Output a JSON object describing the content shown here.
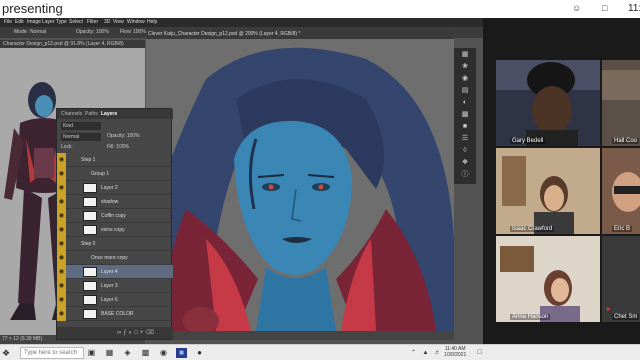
{
  "top": {
    "title": "presenting",
    "clock": "11:"
  },
  "photoshop": {
    "menus": [
      "File",
      "Edit",
      "Image",
      "Layer",
      "Type",
      "Select",
      "Filter",
      "3D",
      "View",
      "Window",
      "Help"
    ],
    "options": {
      "mode_label": "Mode:",
      "mode_value": "Normal",
      "opacity_label": "Opacity:",
      "opacity_value": "100%",
      "flow_label": "Flow:",
      "flow_value": "100%"
    },
    "doc1": {
      "tab": "Character Design_p12.psd @ 91.8% (Layer 4, RGB/8)",
      "status": "77 × 12 (8.38 MB)"
    },
    "doc2": {
      "tab": "Clever Kaiju_Character Design_p12.psd @ 200% (Layer 4, RGB/8) *",
      "status": "200%"
    },
    "layers_panel": {
      "tabs": [
        "Channels",
        "Paths",
        "Layers"
      ],
      "kind_label": "Kind",
      "blend_mode": "Normal",
      "opacity_label": "Opacity:",
      "opacity_value": "100%",
      "lock_label": "Lock:",
      "fill_label": "Fill:",
      "fill_value": "100%",
      "layers": [
        {
          "name": "Step 1"
        },
        {
          "name": "Group 1"
        },
        {
          "name": "Layer 2"
        },
        {
          "name": "shadow"
        },
        {
          "name": "Coffin copy"
        },
        {
          "name": "veins copy"
        },
        {
          "name": "Step 0"
        },
        {
          "name": "Once more copy"
        },
        {
          "name": "Layer 4"
        },
        {
          "name": "Layer 3"
        },
        {
          "name": "Layer 6"
        },
        {
          "name": "BASE COLOR"
        }
      ]
    }
  },
  "participants": [
    {
      "name": "Gary Bedell"
    },
    {
      "name": "Hall Coo"
    },
    {
      "name": "Isaac Crawford"
    },
    {
      "name": "Eric B"
    },
    {
      "name": "Anna Hanson"
    },
    {
      "name": "Chet Sm"
    }
  ],
  "taskbar": {
    "search_placeholder": "Type here to search",
    "time": "11:40 AM",
    "date": "1/30/2021"
  },
  "colors": {
    "layer_eye": "#c9a227",
    "selected_layer": "#5f6b80",
    "character_skin": "#3a86b4"
  }
}
